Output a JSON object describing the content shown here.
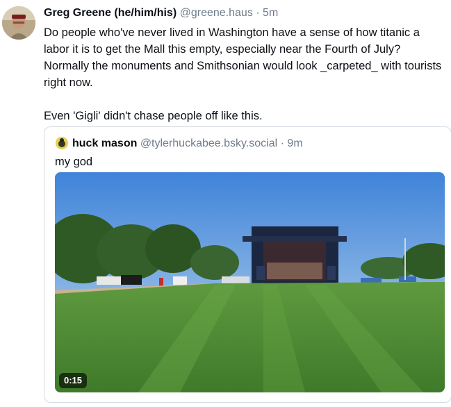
{
  "post": {
    "author_name": "Greg Greene (he/him/his)",
    "handle": "@greene.haus",
    "separator": "·",
    "time": "5m",
    "paragraphs": [
      "Do people who've never lived in Washington have a sense of how titanic a labor it is to get the Mall this empty, especially near the Fourth of July? Normally the monuments and Smithsonian would look _carpeted_ with tourists right now.",
      "Even 'Gigli' didn't chase people off like this."
    ]
  },
  "quote": {
    "author_name": "huck mason",
    "handle": "@tylerhuckabee.bsky.social",
    "separator": "·",
    "time": "9m",
    "text": "my god",
    "video": {
      "duration": "0:15"
    }
  },
  "colors": {
    "text": "#0b0f14",
    "muted": "#6f7c8c",
    "border": "#d4dbe2"
  }
}
